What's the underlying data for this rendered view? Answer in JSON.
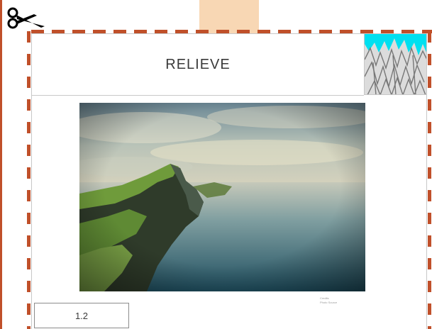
{
  "card": {
    "title": "RELIEVE",
    "number": "1.2",
    "photo_credit": [
      "Credits",
      "Photo Source"
    ]
  },
  "icons": {
    "cut": "scissors-icon",
    "category": "mountain-icon"
  },
  "colors": {
    "cut_line": "#c0502a",
    "tab": "#f8d7b4",
    "sky_icon": "#00e0f0"
  }
}
